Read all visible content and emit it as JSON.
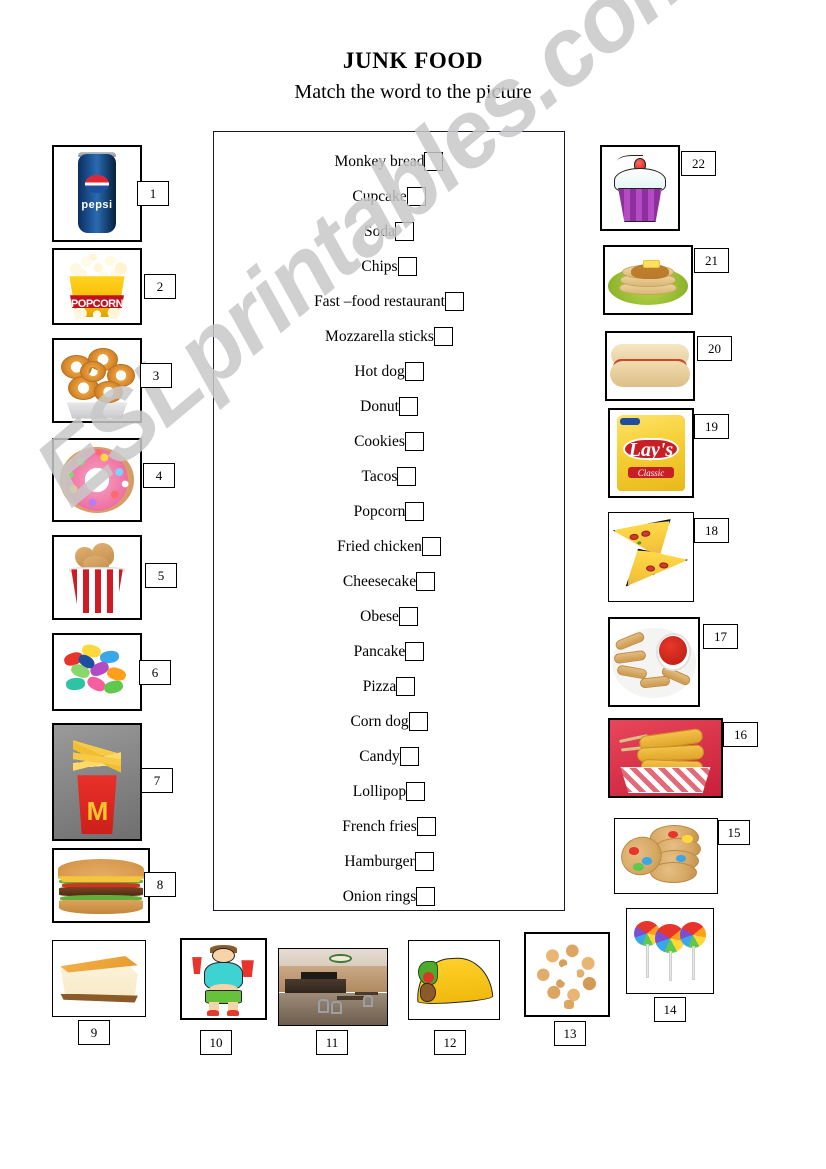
{
  "header": {
    "title": "JUNK FOOD",
    "subtitle": "Match the word to the picture"
  },
  "watermark": {
    "text": "ESLprintables.com"
  },
  "wordlist": [
    {
      "label": "Monkey bread"
    },
    {
      "label": "Cupcake"
    },
    {
      "label": "Soda"
    },
    {
      "label": "Chips"
    },
    {
      "label": "Fast –food restaurant"
    },
    {
      "label": "Mozzarella sticks"
    },
    {
      "label": "Hot dog"
    },
    {
      "label": "Donut"
    },
    {
      "label": "Cookies"
    },
    {
      "label": "Tacos"
    },
    {
      "label": "Popcorn"
    },
    {
      "label": "Fried chicken"
    },
    {
      "label": "Cheesecake"
    },
    {
      "label": "Obese"
    },
    {
      "label": "Pancake"
    },
    {
      "label": "Pizza"
    },
    {
      "label": "Corn dog"
    },
    {
      "label": "Candy"
    },
    {
      "label": "Lollipop"
    },
    {
      "label": "French fries"
    },
    {
      "label": "Hamburger"
    },
    {
      "label": "Onion rings"
    }
  ],
  "pictures": [
    {
      "number": "1",
      "name": "pepsi-can-soda"
    },
    {
      "number": "2",
      "name": "popcorn-bucket"
    },
    {
      "number": "3",
      "name": "onion-rings"
    },
    {
      "number": "4",
      "name": "pink-donut"
    },
    {
      "number": "5",
      "name": "fried-chicken-bucket"
    },
    {
      "number": "6",
      "name": "wrapped-candies"
    },
    {
      "number": "7",
      "name": "mcdonalds-french-fries"
    },
    {
      "number": "8",
      "name": "hamburger"
    },
    {
      "number": "9",
      "name": "cheesecake-slice"
    },
    {
      "number": "10",
      "name": "obese-boy-cartoon"
    },
    {
      "number": "11",
      "name": "fast-food-restaurant-interior"
    },
    {
      "number": "12",
      "name": "taco"
    },
    {
      "number": "13",
      "name": "monkey-bread"
    },
    {
      "number": "14",
      "name": "rainbow-lollipops"
    },
    {
      "number": "15",
      "name": "stack-of-cookies"
    },
    {
      "number": "16",
      "name": "corn-dogs-basket"
    },
    {
      "number": "17",
      "name": "mozzarella-sticks-marinara"
    },
    {
      "number": "18",
      "name": "pizza-slices"
    },
    {
      "number": "19",
      "name": "lays-chips-bag"
    },
    {
      "number": "20",
      "name": "hot-dog"
    },
    {
      "number": "21",
      "name": "pancakes-plate"
    },
    {
      "number": "22",
      "name": "cupcake-cherry"
    }
  ],
  "brands": {
    "pepsi": "pepsi",
    "popcorn_band": "POPCORN",
    "mcdonalds_arch": "M",
    "lays": "Lay's",
    "lays_classic": "Classic"
  }
}
